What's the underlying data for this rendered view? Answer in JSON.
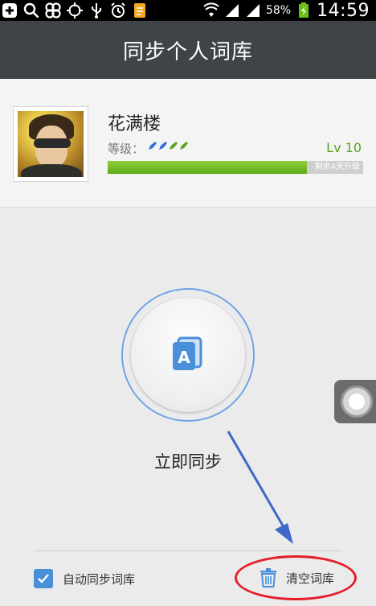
{
  "status_bar": {
    "battery_percent": "58%",
    "time": "14:59",
    "left_icons": [
      "add-box-icon",
      "search-icon",
      "cloverleaf-icon",
      "crosshair-icon",
      "usb-icon",
      "alarm-icon",
      "file-icon"
    ],
    "right_icons": [
      "wifi-icon",
      "signal-icon",
      "signal-icon",
      "battery-charging-icon"
    ]
  },
  "title_bar": {
    "title": "同步个人词库"
  },
  "profile": {
    "username": "花满楼",
    "level_label": "等级：",
    "level_value": "Lv 10",
    "progress_fraction": 0.78,
    "progress_text": "剩余4天升级",
    "colors": {
      "level_green": "#5aa21e",
      "progress_green": "#6bb81f"
    }
  },
  "sync": {
    "button_icon": "book-icon",
    "label": "立即同步",
    "ring_color": "#6fa3e6"
  },
  "footer": {
    "auto_sync_label": "自动同步词库",
    "auto_sync_checked": true,
    "clear_label": "清空词库",
    "clear_icon": "trash-icon",
    "highlight_color": "#e41e2a",
    "arrow_color": "#3f66c9"
  }
}
